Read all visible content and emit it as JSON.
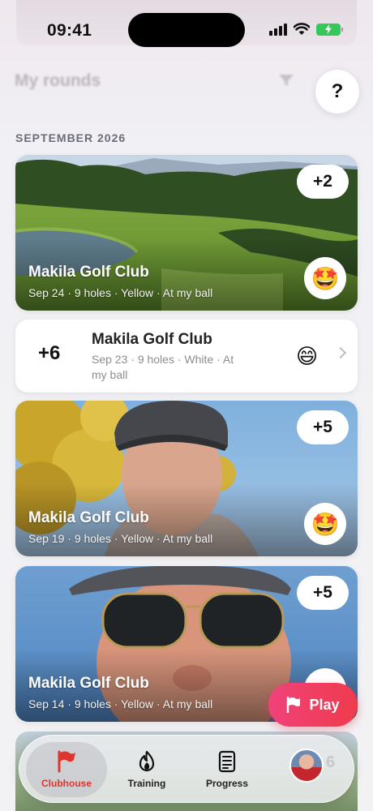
{
  "status_bar": {
    "time": "09:41"
  },
  "header": {
    "title": "My rounds",
    "help_label": "?"
  },
  "section": {
    "title": "SEPTEMBER 2026"
  },
  "rounds": [
    {
      "course": "Makila Golf Club",
      "meta": "Sep 24  · 9 holes  · Yellow  · At my ball",
      "score": "+2",
      "emoji": "🤩"
    },
    {
      "course": "Makila Golf Club",
      "meta": "Sep 23 · 9 holes · White · At my ball",
      "score": "+6",
      "emoji": "😄"
    },
    {
      "course": "Makila Golf Club",
      "meta": "Sep 19  · 9 holes  · Yellow  · At my ball",
      "score": "+5",
      "emoji": "🤩"
    },
    {
      "course": "Makila Golf Club",
      "meta": "Sep 14  · 9 holes  · Yellow  · At my ball",
      "score": "+5"
    }
  ],
  "play_button": {
    "label": "Play"
  },
  "tabs": [
    {
      "label": "Clubhouse",
      "icon": "flag-icon",
      "active": true
    },
    {
      "label": "Training",
      "icon": "flame-icon"
    },
    {
      "label": "Progress",
      "icon": "scorecard-icon"
    }
  ],
  "colors": {
    "accent": "#e0342f",
    "play_start": "#f0427a",
    "play_end": "#ef3b4c",
    "battery": "#34c759"
  }
}
